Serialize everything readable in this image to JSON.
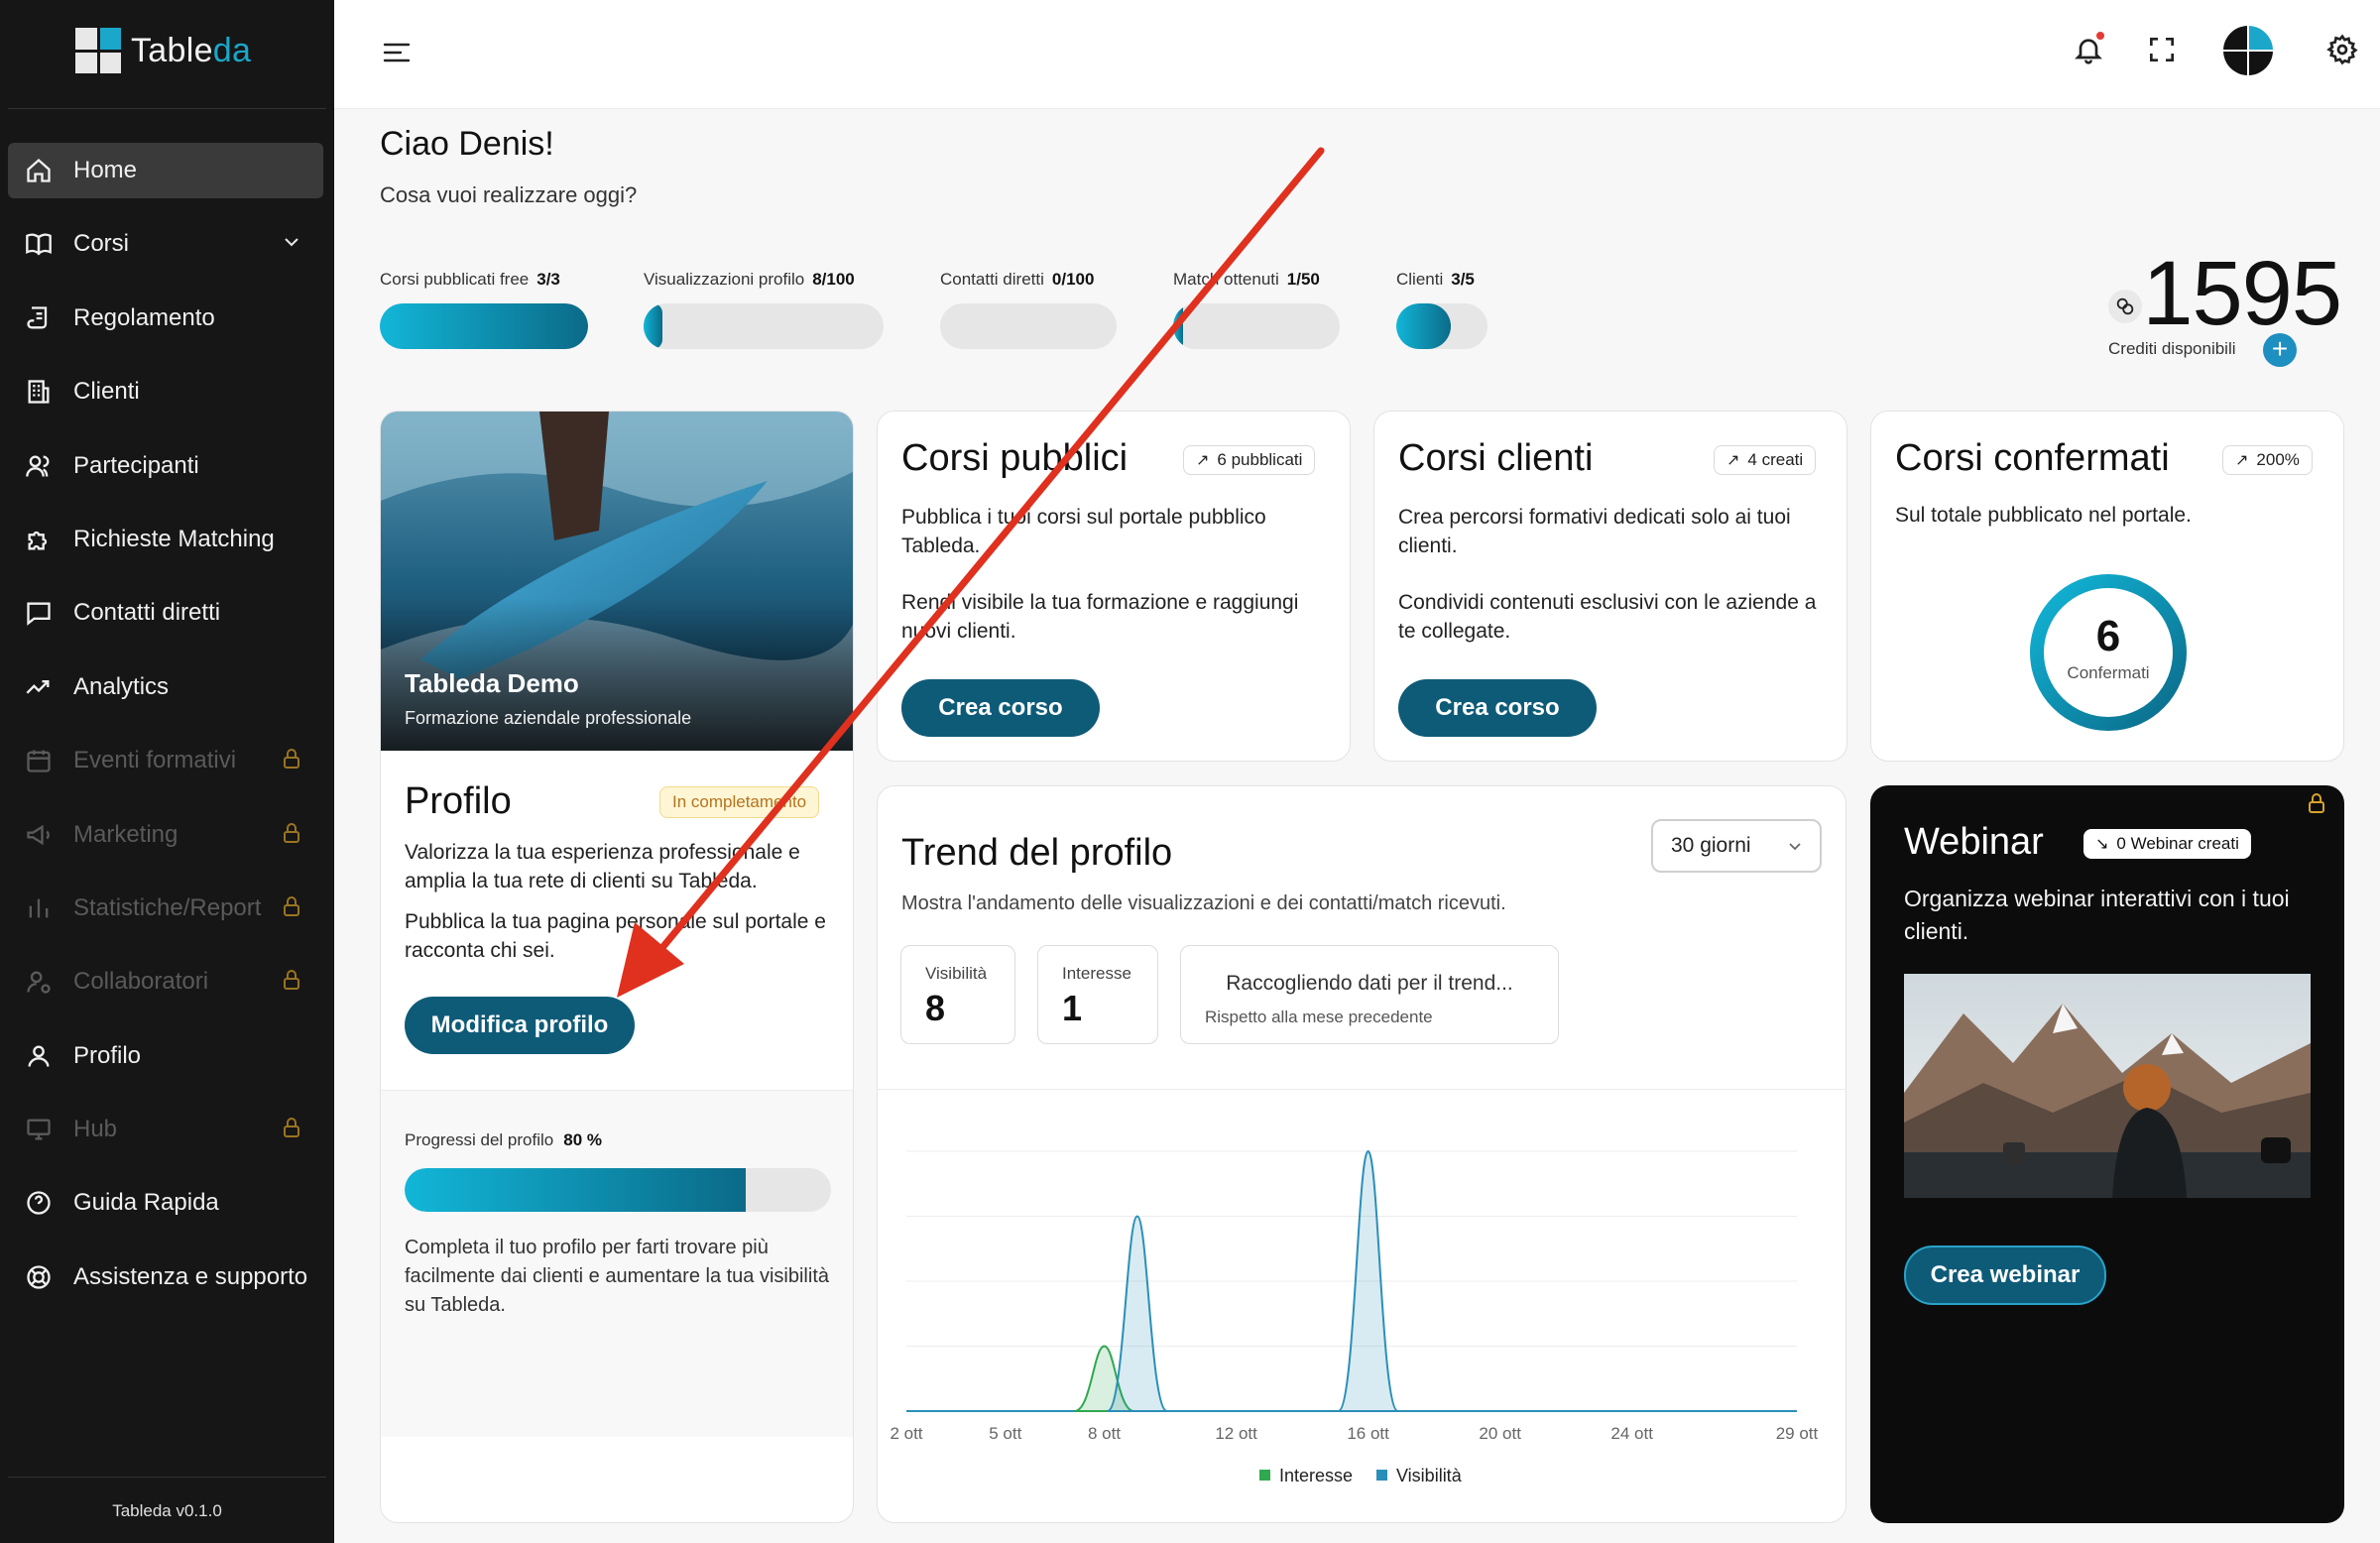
{
  "app": {
    "logo_main": "Table",
    "logo_accent": "da",
    "version": "Tableda v0.1.0"
  },
  "sidebar": {
    "items": [
      {
        "label": "Home",
        "icon": "home-icon",
        "active": true
      },
      {
        "label": "Corsi",
        "icon": "book-icon",
        "expandable": true
      },
      {
        "label": "Regolamento",
        "icon": "scroll-icon"
      },
      {
        "label": "Clienti",
        "icon": "building-icon"
      },
      {
        "label": "Partecipanti",
        "icon": "users-icon"
      },
      {
        "label": "Richieste Matching",
        "icon": "puzzle-icon"
      },
      {
        "label": "Contatti diretti",
        "icon": "message-icon"
      },
      {
        "label": "Analytics",
        "icon": "trend-icon"
      },
      {
        "label": "Eventi formativi",
        "icon": "calendar-icon",
        "locked": true
      },
      {
        "label": "Marketing",
        "icon": "megaphone-icon",
        "locked": true
      },
      {
        "label": "Statistiche/Report",
        "icon": "bar-chart-icon",
        "locked": true
      },
      {
        "label": "Collaboratori",
        "icon": "user-cog-icon",
        "locked": true
      },
      {
        "label": "Profilo",
        "icon": "user-icon"
      },
      {
        "label": "Hub",
        "icon": "monitor-icon",
        "locked": true
      },
      {
        "label": "Guida Rapida",
        "icon": "help-circle-icon"
      },
      {
        "label": "Assistenza e supporto",
        "icon": "lifebuoy-icon"
      }
    ]
  },
  "header": {
    "greeting": "Ciao Denis!",
    "subtitle": "Cosa vuoi realizzare oggi?"
  },
  "stats": [
    {
      "label": "Corsi pubblicati free",
      "value": "3/3",
      "fraction": 1.0
    },
    {
      "label": "Visualizzazioni profilo",
      "value": "8/100",
      "fraction": 0.08
    },
    {
      "label": "Contatti diretti",
      "value": "0/100",
      "fraction": 0.0
    },
    {
      "label": "Match ottenuti",
      "value": "1/50",
      "fraction": 0.02
    },
    {
      "label": "Clienti",
      "value": "3/5",
      "fraction": 0.6
    }
  ],
  "credits": {
    "value": "1595",
    "label": "Crediti disponibili"
  },
  "profile": {
    "name": "Tableda Demo",
    "tagline": "Formazione aziendale professionale",
    "title": "Profilo",
    "badge": "In completamento",
    "text1": "Valorizza la tua esperienza professionale e amplia la tua rete di clienti su Tableda.",
    "text2": "Pubblica la tua pagina personale sul portale e racconta chi sei.",
    "button": "Modifica profilo",
    "progress_label": "Progressi del profilo",
    "progress_value": "80 %",
    "progress_fraction": 0.8,
    "progress_text": "Completa il tuo profilo per farti trovare più facilmente dai clienti e aumentare la tua visibilità su Tableda."
  },
  "corsi_pubblici": {
    "title": "Corsi pubblici",
    "badge": "6 pubblicati",
    "text1": "Pubblica i tuoi corsi sul portale pubblico Tableda.",
    "text2": "Rendi visibile la tua formazione e raggiungi nuovi clienti.",
    "button": "Crea corso"
  },
  "corsi_clienti": {
    "title": "Corsi clienti",
    "badge": "4 creati",
    "text1": "Crea percorsi formativi dedicati solo ai tuoi clienti.",
    "text2": "Condividi contenuti esclusivi con le aziende a te collegate.",
    "button": "Crea corso"
  },
  "corsi_confermati": {
    "title": "Corsi confermati",
    "badge": "200%",
    "text": "Sul totale pubblicato nel portale.",
    "count": "6",
    "count_label": "Confermati"
  },
  "trend": {
    "title": "Trend del profilo",
    "subtitle": "Mostra l'andamento delle visualizzazioni e dei contatti/match ricevuti.",
    "period": "30 giorni",
    "metrics": [
      {
        "label": "Visibilità",
        "value": "8"
      },
      {
        "label": "Interesse",
        "value": "1"
      }
    ],
    "collecting": "Raccogliendo dati per il trend...",
    "collecting_sub": "Rispetto alla mese precedente"
  },
  "chart_data": {
    "type": "area",
    "x_ticks": [
      "2 ott",
      "5 ott",
      "8 ott",
      "12 ott",
      "16 ott",
      "20 ott",
      "24 ott",
      "29 ott"
    ],
    "series": [
      {
        "name": "Interesse",
        "color": "#2fa84f",
        "peaks": [
          {
            "day": 8,
            "value": 1
          }
        ]
      },
      {
        "name": "Visibilità",
        "color": "#2a8fb8",
        "peaks": [
          {
            "day": 9,
            "value": 3
          },
          {
            "day": 16,
            "value": 4
          }
        ]
      }
    ],
    "legend_position": "bottom-center",
    "grid": true
  },
  "webinar": {
    "title": "Webinar",
    "badge": "0 Webinar creati",
    "text": "Organizza webinar interattivi con i tuoi clienti.",
    "button": "Crea webinar"
  },
  "colors": {
    "accent": "#0e5b78",
    "accent_light": "#12b6d8",
    "sidebar_bg": "#161616",
    "annotation_arrow": "#e0301e"
  }
}
